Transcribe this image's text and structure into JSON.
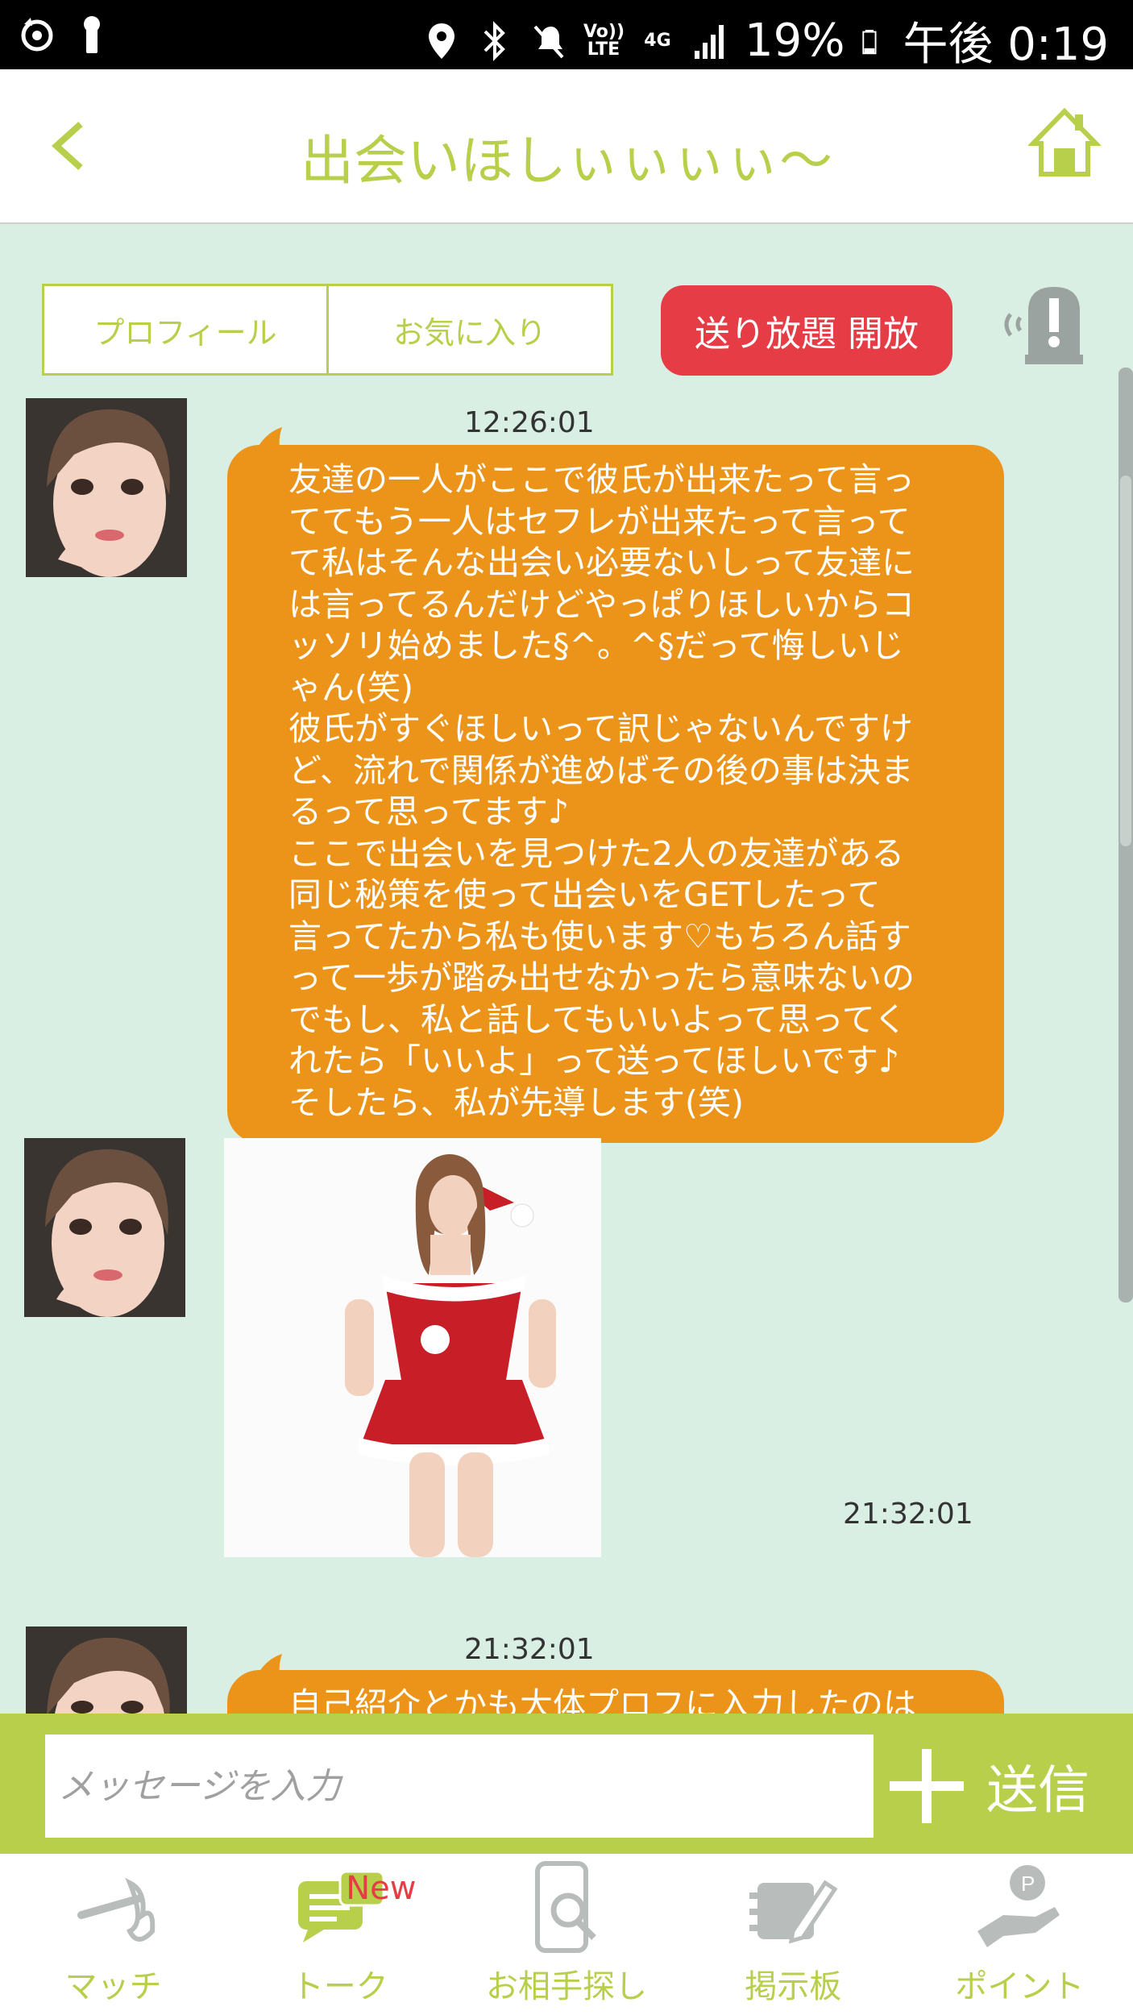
{
  "status_bar": {
    "volte": "Vo)) LTE",
    "network": "4G",
    "battery": "19%",
    "time": "午後 0:19"
  },
  "header": {
    "title": "出会いほしぃぃぃぃ〜"
  },
  "actions": {
    "profile_label": "プロフィール",
    "favorite_label": "お気に入り",
    "unlimited_label": "送り放題 開放"
  },
  "messages": [
    {
      "timestamp": "12:26:01",
      "text": "友達の一人がここで彼氏が出来たって言っ\nててもう一人はセフレが出来たって言って\nて私はそんな出会い必要ないしって友達に\nは言ってるんだけどやっぱりほしいからコ\nッソリ始めました§^。^§だって悔しいじ\nゃん(笑)\n彼氏がすぐほしいって訳じゃないんですけ\nど、流れで関係が進めばその後の事は決ま\nるって思ってます♪\nここで出会いを見つけた2人の友達がある\n同じ秘策を使って出会いをGETしたって\n言ってたから私も使います♡もちろん話す\nって一歩が踏み出せなかったら意味ないの\nでもし、私と話してもいいよって思ってく\nれたら「いいよ」って送ってほしいです♪\nそしたら、私が先導します(笑)"
    },
    {
      "timestamp": "21:32:01",
      "image": "santa-photo"
    },
    {
      "timestamp": "21:32:01",
      "text": "自己紹介とかも大体プロフに入力したのは"
    }
  ],
  "input": {
    "placeholder": "メッセージを入力",
    "send_label": "送信"
  },
  "nav": [
    {
      "label": "マッチ",
      "icon": "match-icon"
    },
    {
      "label": "トーク",
      "icon": "talk-icon",
      "badge": "New"
    },
    {
      "label": "お相手探し",
      "icon": "search-partner-icon"
    },
    {
      "label": "掲示板",
      "icon": "board-icon"
    },
    {
      "label": "ポイント",
      "icon": "point-icon"
    }
  ],
  "colors": {
    "accent": "#b7cf4b",
    "bubble": "#eb9419",
    "danger": "#e63c46",
    "background": "#d9efe3"
  }
}
